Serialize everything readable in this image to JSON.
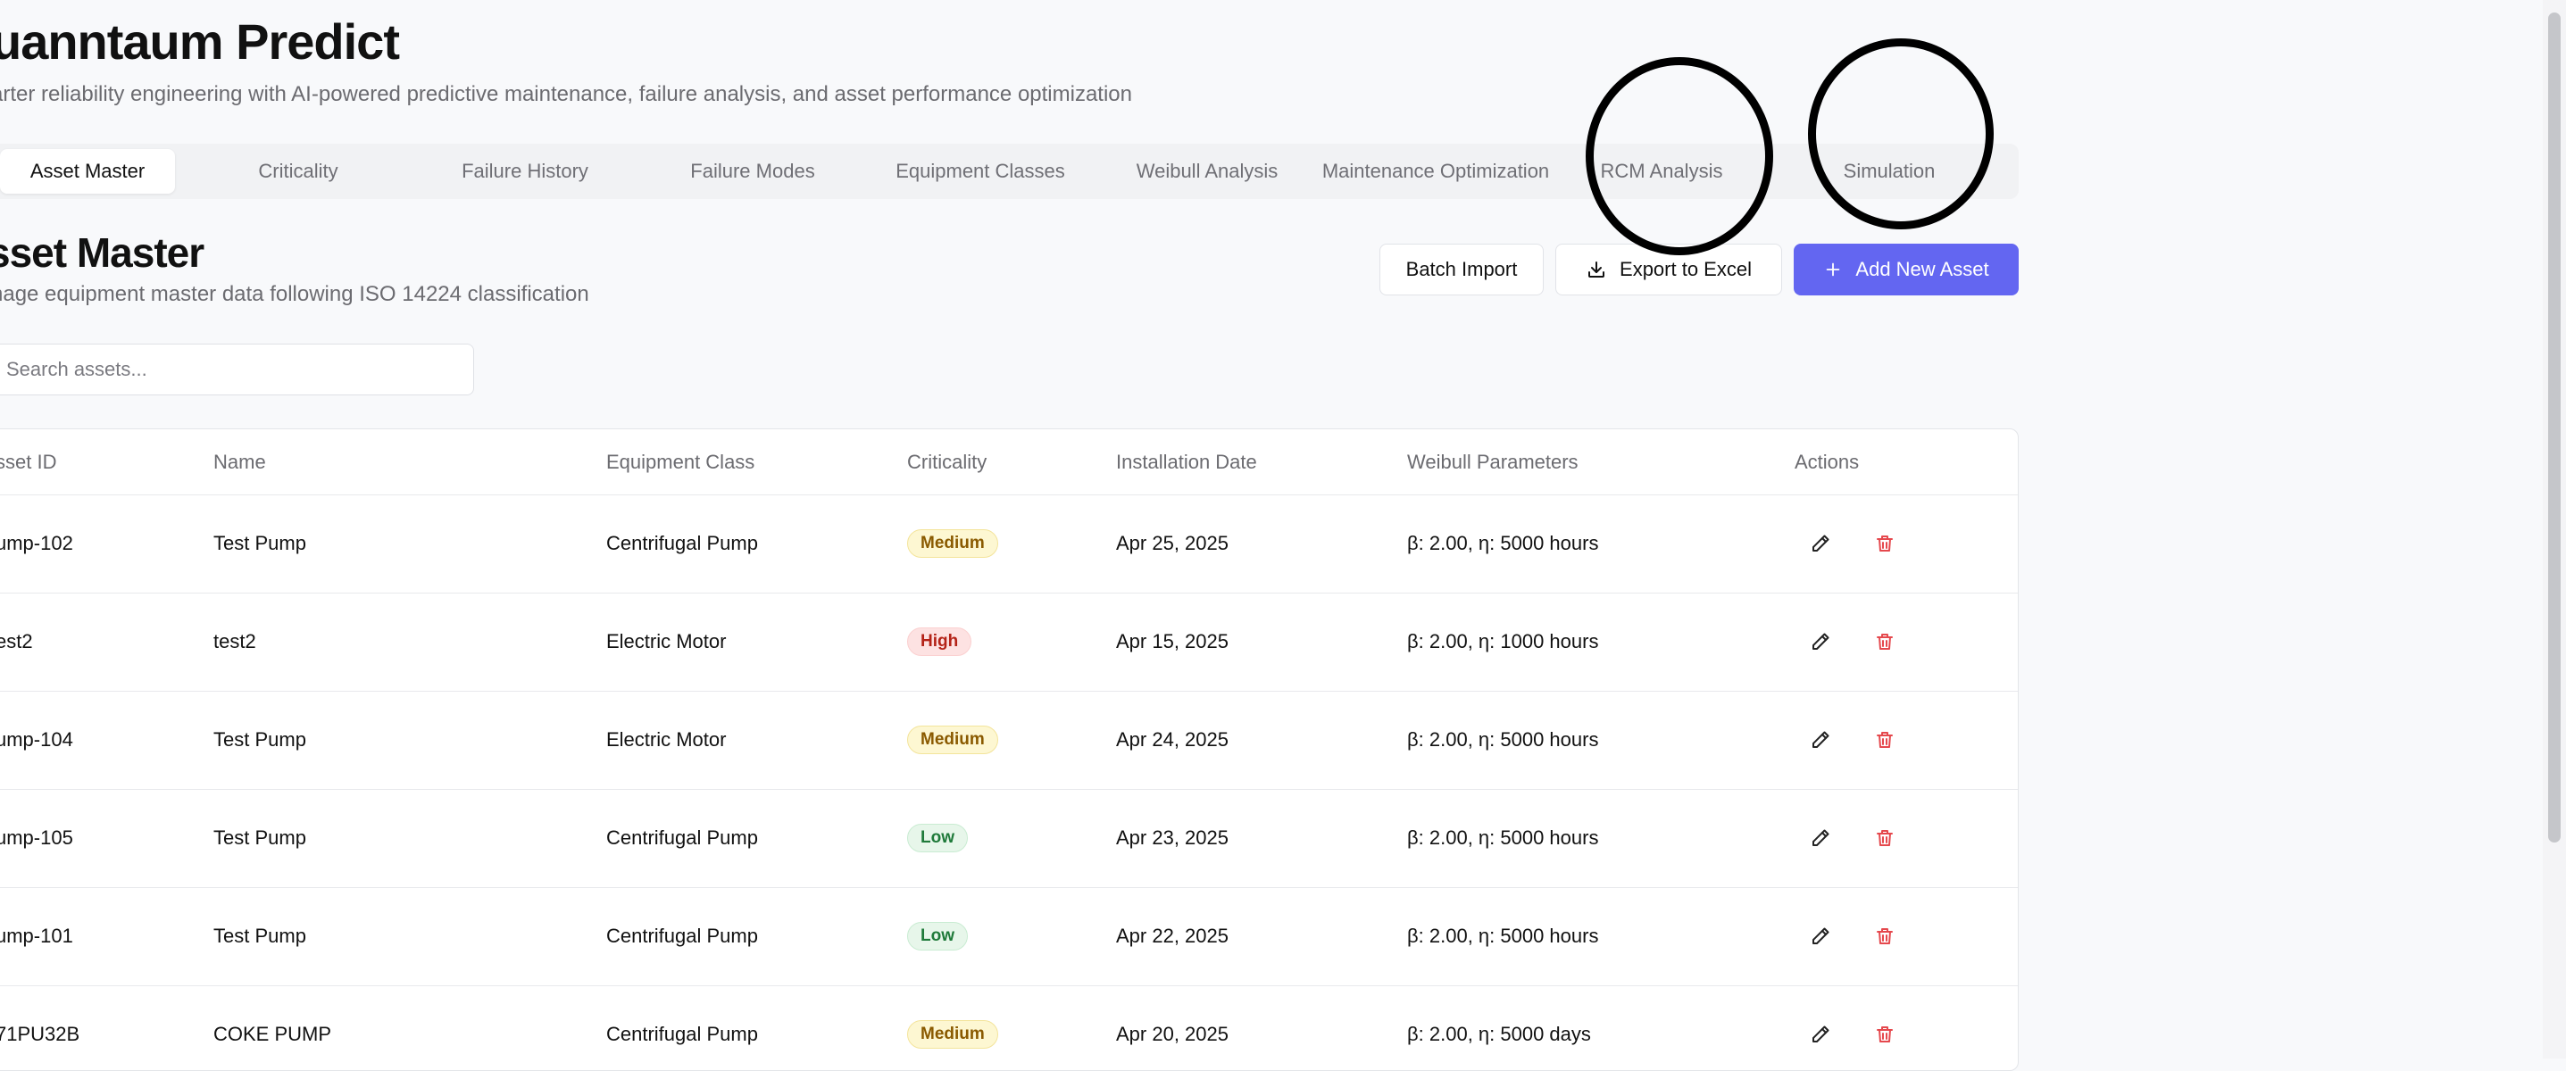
{
  "app": {
    "title": "uanntaum Predict",
    "subtitle": "arter reliability engineering with AI-powered predictive maintenance, failure analysis, and asset performance optimization"
  },
  "tabs": [
    {
      "label": "Asset Master",
      "active": true
    },
    {
      "label": "Criticality",
      "active": false
    },
    {
      "label": "Failure History",
      "active": false
    },
    {
      "label": "Failure Modes",
      "active": false
    },
    {
      "label": "Equipment Classes",
      "active": false
    },
    {
      "label": "Weibull Analysis",
      "active": false
    },
    {
      "label": "Maintenance Optimization",
      "active": false
    },
    {
      "label": "RCM Analysis",
      "active": false
    },
    {
      "label": "Simulation",
      "active": false
    }
  ],
  "section": {
    "title": "sset Master",
    "description": "nage equipment master data following ISO 14224 classification"
  },
  "actions": {
    "batch_import": "Batch Import",
    "export_excel": "Export to Excel",
    "add_asset": "Add New Asset"
  },
  "search": {
    "placeholder": "Search assets...",
    "value": ""
  },
  "table": {
    "columns": [
      "sset ID",
      "Name",
      "Equipment Class",
      "Criticality",
      "Installation Date",
      "Weibull Parameters",
      "Actions"
    ],
    "rows": [
      {
        "id": "ump-102",
        "name": "Test Pump",
        "class": "Centrifugal Pump",
        "criticality": "Medium",
        "date": "Apr 25, 2025",
        "weibull": "β: 2.00, η: 5000 hours"
      },
      {
        "id": "est2",
        "name": "test2",
        "class": "Electric Motor",
        "criticality": "High",
        "date": "Apr 15, 2025",
        "weibull": "β: 2.00, η: 1000 hours"
      },
      {
        "id": "ump-104",
        "name": "Test Pump",
        "class": "Electric Motor",
        "criticality": "Medium",
        "date": "Apr 24, 2025",
        "weibull": "β: 2.00, η: 5000 hours"
      },
      {
        "id": "ump-105",
        "name": "Test Pump",
        "class": "Centrifugal Pump",
        "criticality": "Low",
        "date": "Apr 23, 2025",
        "weibull": "β: 2.00, η: 5000 hours"
      },
      {
        "id": "ump-101",
        "name": "Test Pump",
        "class": "Centrifugal Pump",
        "criticality": "Low",
        "date": "Apr 22, 2025",
        "weibull": "β: 2.00, η: 5000 hours"
      },
      {
        "id": "71PU32B",
        "name": "COKE PUMP",
        "class": "Centrifugal Pump",
        "criticality": "Medium",
        "date": "Apr 20, 2025",
        "weibull": "β: 2.00, η: 5000 days"
      }
    ]
  },
  "colors": {
    "accent": "#6366f1",
    "delete": "#e5484d",
    "annotation": "#000000"
  },
  "icons": {
    "export": "download-icon",
    "add": "plus-icon",
    "edit": "pencil-icon",
    "delete": "trash-icon"
  }
}
